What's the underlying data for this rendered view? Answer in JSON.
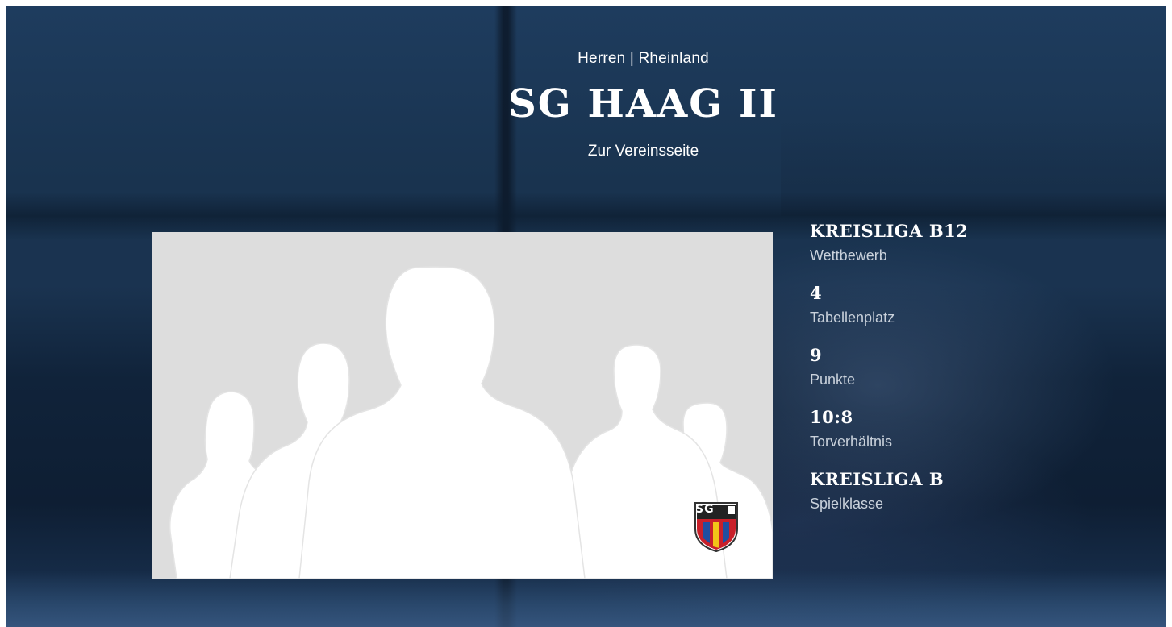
{
  "header": {
    "category": "Herren | Rheinland",
    "team_name": "SG HAAG II",
    "club_link": "Zur Vereinsseite"
  },
  "crest": {
    "text": "SG"
  },
  "stats": [
    {
      "value": "KREISLIGA B12",
      "label": "Wettbewerb"
    },
    {
      "value": "4",
      "label": "Tabellenplatz"
    },
    {
      "value": "9",
      "label": "Punkte"
    },
    {
      "value": "10:8",
      "label": "Torverhältnis"
    },
    {
      "value": "KREISLIGA B",
      "label": "Spielklasse"
    }
  ],
  "colors": {
    "background_dark": "#10233a",
    "photo_placeholder": "#dddddd",
    "silhouette": "#ffffff",
    "crest_red": "#c8202a",
    "crest_blue": "#1f4fa0",
    "crest_yellow": "#f2c418"
  },
  "icons": {
    "team_photo": "team-silhouette-placeholder",
    "crest": "club-crest-logo"
  }
}
